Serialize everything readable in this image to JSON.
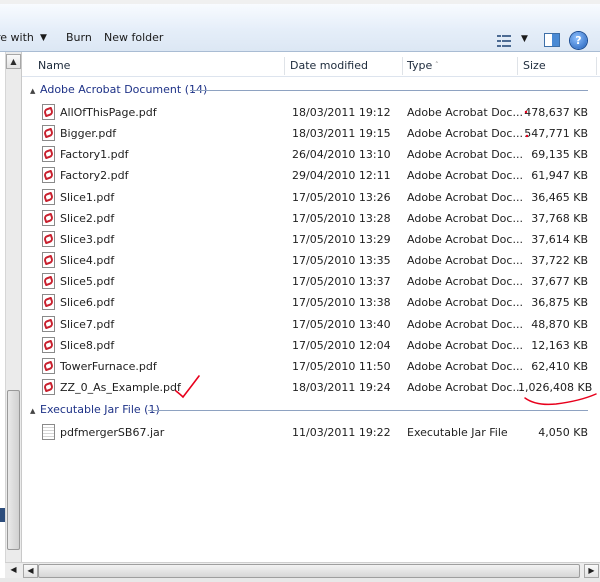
{
  "toolbar": {
    "share_label": "re with",
    "burn_label": "Burn",
    "new_folder_label": "New folder",
    "help_glyph": "?",
    "caret_glyph": "▼"
  },
  "columns": {
    "name": "Name",
    "date": "Date modified",
    "type": "Type",
    "size": "Size",
    "sort_indicator": "˄"
  },
  "groups": [
    {
      "label": "Adobe Acrobat Document (14)",
      "files": [
        {
          "name": "AllOfThisPage.pdf",
          "date": "18/03/2011 19:12",
          "type": "Adobe Acrobat Doc...",
          "size": "478,637 KB"
        },
        {
          "name": "Bigger.pdf",
          "date": "18/03/2011 19:15",
          "type": "Adobe Acrobat Doc...",
          "size": "547,771 KB"
        },
        {
          "name": "Factory1.pdf",
          "date": "26/04/2010 13:10",
          "type": "Adobe Acrobat Doc...",
          "size": "69,135 KB"
        },
        {
          "name": "Factory2.pdf",
          "date": "29/04/2010 12:11",
          "type": "Adobe Acrobat Doc...",
          "size": "61,947 KB"
        },
        {
          "name": "Slice1.pdf",
          "date": "17/05/2010 13:26",
          "type": "Adobe Acrobat Doc...",
          "size": "36,465 KB"
        },
        {
          "name": "Slice2.pdf",
          "date": "17/05/2010 13:28",
          "type": "Adobe Acrobat Doc...",
          "size": "37,768 KB"
        },
        {
          "name": "Slice3.pdf",
          "date": "17/05/2010 13:29",
          "type": "Adobe Acrobat Doc...",
          "size": "37,614 KB"
        },
        {
          "name": "Slice4.pdf",
          "date": "17/05/2010 13:35",
          "type": "Adobe Acrobat Doc...",
          "size": "37,722 KB"
        },
        {
          "name": "Slice5.pdf",
          "date": "17/05/2010 13:37",
          "type": "Adobe Acrobat Doc...",
          "size": "37,677 KB"
        },
        {
          "name": "Slice6.pdf",
          "date": "17/05/2010 13:38",
          "type": "Adobe Acrobat Doc...",
          "size": "36,875 KB"
        },
        {
          "name": "Slice7.pdf",
          "date": "17/05/2010 13:40",
          "type": "Adobe Acrobat Doc...",
          "size": "48,870 KB"
        },
        {
          "name": "Slice8.pdf",
          "date": "17/05/2010 12:04",
          "type": "Adobe Acrobat Doc...",
          "size": "12,163 KB"
        },
        {
          "name": "TowerFurnace.pdf",
          "date": "17/05/2010 11:50",
          "type": "Adobe Acrobat Doc...",
          "size": "62,410 KB"
        },
        {
          "name": "ZZ_0_As_Example.pdf",
          "date": "18/03/2011 19:24",
          "type": "Adobe Acrobat Doc...",
          "size": "1,026,408 KB"
        }
      ]
    },
    {
      "label": "Executable Jar File (1)",
      "files": [
        {
          "name": "pdfmergerSB67.jar",
          "date": "11/03/2011 19:22",
          "type": "Executable Jar File",
          "size": "4,050 KB"
        }
      ]
    }
  ],
  "colors": {
    "group_header_text": "#1e3287",
    "annotation_red": "#e8001c",
    "toolbar_bg": "#dce7f4"
  }
}
